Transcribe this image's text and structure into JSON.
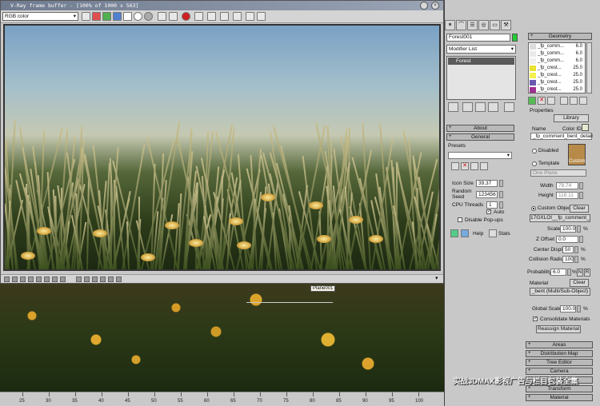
{
  "vfb": {
    "title": "V-Ray frame buffer - [100% of 1000 x 563]",
    "channel": "RGB color"
  },
  "viewport": {
    "plane_label": "Plane001",
    "ruler": [
      "25",
      "30",
      "35",
      "40",
      "45",
      "50",
      "55",
      "60",
      "65",
      "70",
      "75",
      "80",
      "85",
      "90",
      "95",
      "100"
    ]
  },
  "panel": {
    "object_name": "Forest001",
    "modifier_list": "Modifier List",
    "stack_item": "Forest",
    "about": "About",
    "general": "General",
    "presets_label": "Presets",
    "icon_size_label": "Icon Size",
    "icon_size_value": "39.37",
    "random_seed_label": "Random Seed",
    "random_seed_value": "123456",
    "cpu_threads_label": "CPU Threads",
    "cpu_threads_value": "1",
    "auto_label": "Auto",
    "disable_popups_label": "Disable Pop-ups",
    "help_label": "Help",
    "stats_label": "Stats"
  },
  "geometry": {
    "header": "Geometry",
    "items": [
      {
        "name": "_fp_comm...",
        "value": "6.0",
        "color": "#dcdcdc"
      },
      {
        "name": "_fp_comm...",
        "value": "6.0",
        "color": "#eaeaea"
      },
      {
        "name": "_fp_comm...",
        "value": "6.0",
        "color": "#f0f0f0"
      },
      {
        "name": "_fp_crest...",
        "value": "25.0",
        "color": "#e8e232"
      },
      {
        "name": "_fp_crest...",
        "value": "25.0",
        "color": "#f3f050"
      },
      {
        "name": "_fp_crest...",
        "value": "25.0",
        "color": "#6a5ab0"
      },
      {
        "name": "_fp_crest...",
        "value": "25.0",
        "color": "#a03090"
      },
      {
        "name": "_fp_festu...",
        "value": "25.0",
        "color": "#4a4ab0"
      }
    ],
    "properties": "Properties",
    "library": "Library",
    "name_label": "Name",
    "color_id_label": "Color ID",
    "name_value": "_fp_comment_bent_detail",
    "disabled_label": "Disabled",
    "template_label": "Template",
    "custom_label": "Custom",
    "one_plane": "One Plane",
    "width_label": "Width",
    "width_value": "78.74",
    "height_label": "Height",
    "height_value": "118.11",
    "custom_object_label": "Custom Object",
    "clear_label": "Clear",
    "custom_object_value": "17GXLOI__fp_comment_ber",
    "scale_label": "Scale",
    "scale_value": "100.0",
    "zoffset_label": "Z Offset",
    "zoffset_value": "0.0",
    "center_displ_label": "Center Displ.",
    "center_displ_value": "50",
    "collision_label": "Collision Radius",
    "collision_value": "100",
    "probability_label": "Probability",
    "probability_value": "6.0",
    "n_label": "N",
    "r_label": "R",
    "material_label": "Material",
    "material_clear": "Clear",
    "material_value": "_bent (Multi/Sub-Object)",
    "global_scale_label": "Global Scale",
    "global_scale_value": "100.0",
    "consolidate_label": "Consolidate Materials",
    "reassign_label": "Reassign Material",
    "percent": "%"
  },
  "rollouts": [
    "Areas",
    "Distribution Map",
    "Tree Editor",
    "Camera",
    "Surface",
    "Transform",
    "Material"
  ],
  "watermark": "实战3DMAX影视广告与栏目包装全集"
}
